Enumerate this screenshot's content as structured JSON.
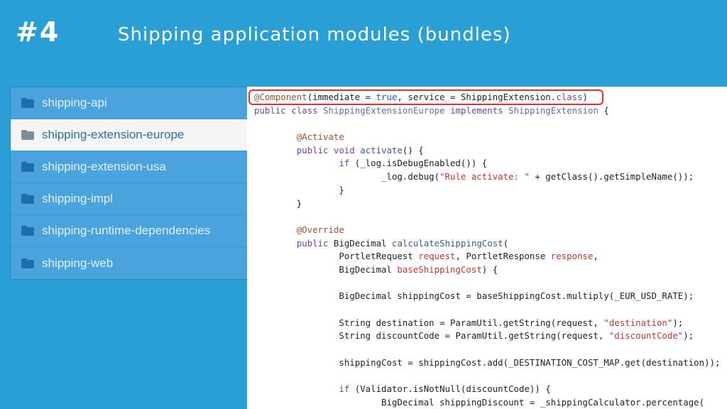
{
  "header": {
    "number": "#4",
    "title": "Shipping application modules (bundles)"
  },
  "modules": [
    {
      "name": "shipping-api",
      "active": false
    },
    {
      "name": "shipping-extension-europe",
      "active": true
    },
    {
      "name": "shipping-extension-usa",
      "active": false
    },
    {
      "name": "shipping-impl",
      "active": false
    },
    {
      "name": "shipping-runtime-dependencies",
      "active": false
    },
    {
      "name": "shipping-web",
      "active": false
    }
  ],
  "code": {
    "language": "java",
    "highlighted_line": 0,
    "lines": [
      "@Component(immediate = true, service = ShippingExtension.class)",
      "public class ShippingExtensionEurope implements ShippingExtension {",
      "",
      "        @Activate",
      "        public void activate() {",
      "                if (_log.isDebugEnabled()) {",
      "                        _log.debug(\"Rule activate: \" + getClass().getSimpleName());",
      "                }",
      "        }",
      "",
      "        @Override",
      "        public BigDecimal calculateShippingCost(",
      "                PortletRequest request, PortletResponse response,",
      "                BigDecimal baseShippingCost) {",
      "",
      "                BigDecimal shippingCost = baseShippingCost.multiply(_EUR_USD_RATE);",
      "",
      "                String destination = ParamUtil.getString(request, \"destination\");",
      "                String discountCode = ParamUtil.getString(request, \"discountCode\");",
      "",
      "                shippingCost = shippingCost.add(_DESTINATION_COST_MAP.get(destination));",
      "",
      "                if (Validator.isNotNull(discountCode)) {",
      "                        BigDecimal shippingDiscount = _shippingCalculator.percentage("
    ]
  },
  "colors": {
    "background": "#2a9fd6",
    "active_item": "#f5f5f5",
    "highlight_border": "#e03131"
  }
}
